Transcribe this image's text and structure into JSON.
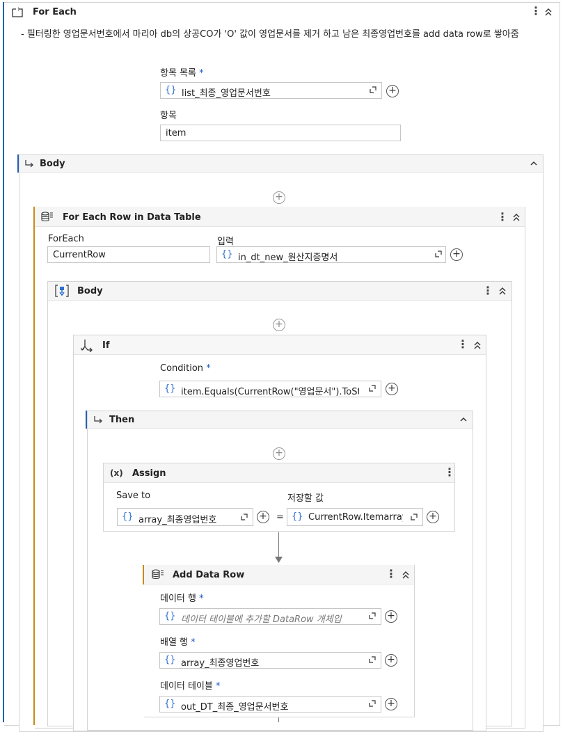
{
  "foreach": {
    "title": "For Each",
    "description": "- 필터링한 영업문서번호에서 마리아 db의 상공CO가 'O' 값이 영업문서를 제거 하고 남은 최종영업번호를 add data row로 쌓아줌",
    "list_label": "항목 목록",
    "list_value": "list_최종_영업문서번호",
    "item_label": "항목",
    "item_value": "item",
    "required_mark": "*"
  },
  "body1": {
    "title": "Body"
  },
  "foreach_row": {
    "title": "For Each Row in Data Table",
    "foreach_label": "ForEach",
    "foreach_value": "CurrentRow",
    "input_label": "입력",
    "input_value": "in_dt_new_원산지증명서"
  },
  "body2": {
    "title": "Body"
  },
  "if_block": {
    "title": "If",
    "condition_label": "Condition",
    "condition_value": "item.Equals(CurrentRow(\"영업문서\").ToSt"
  },
  "then_block": {
    "title": "Then"
  },
  "assign": {
    "icon_text": "(x)",
    "title": "Assign",
    "save_to_label": "Save to",
    "value_label": "저장할 값",
    "save_to_value": "array_최종영업번호",
    "equals": "=",
    "value_value": "CurrentRow.Itemarray"
  },
  "add_data_row": {
    "title": "Add Data Row",
    "data_row_label": "데이터 행",
    "data_row_placeholder": "데이터 테이블에 추가할 DataRow 개체입",
    "array_row_label": "배열 행",
    "array_row_value": "array_최종영업번호",
    "data_table_label": "데이터 테이블",
    "data_table_value": "out_DT_최종_영업문서번호"
  },
  "icons": {
    "foreach": "foreach-icon",
    "body": "body-arrow-icon",
    "database": "database-icon",
    "sequence": "sequence-icon",
    "if": "if-branch-icon",
    "assign": "assign-icon",
    "expand": "expand-editor-icon",
    "plus": "plus-circle-icon",
    "kebab": "more-icon",
    "collapse": "collapse-icon"
  },
  "colors": {
    "accent_blue": "#1f5fb9",
    "accent_orange": "#c98a1a",
    "brace_blue": "#2f6fd1"
  }
}
